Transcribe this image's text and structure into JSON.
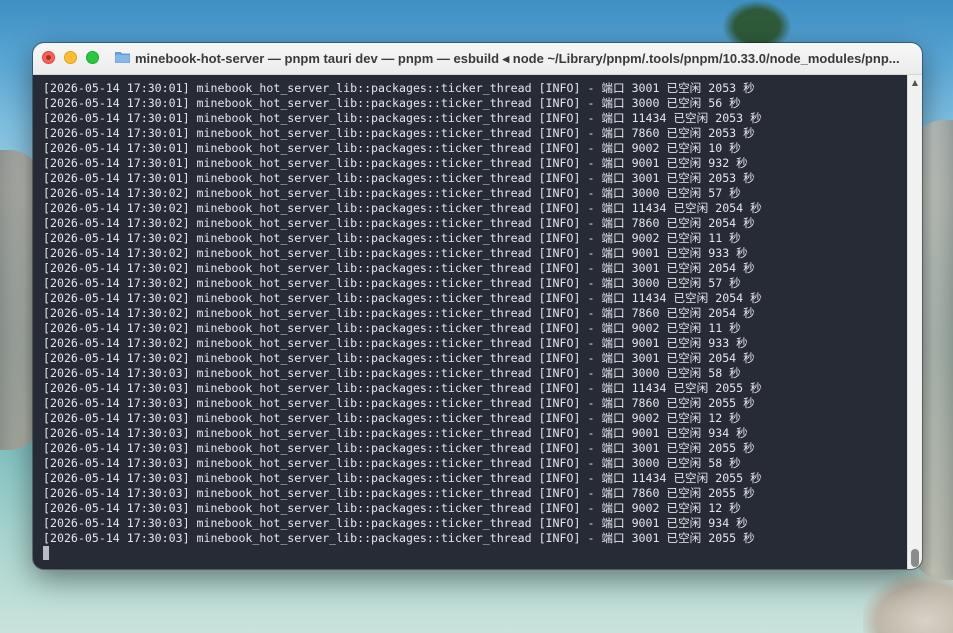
{
  "window": {
    "title": "minebook-hot-server — pnpm tauri dev — pnpm — esbuild ◂ node ~/Library/pnpm/.tools/pnpm/10.33.0/node_modules/pnp..."
  },
  "terminal": {
    "lines": [
      "[2026-05-14 17:30:01] minebook_hot_server_lib::packages::ticker_thread [INFO] - 端口 3001 已空闲 2053 秒",
      "[2026-05-14 17:30:01] minebook_hot_server_lib::packages::ticker_thread [INFO] - 端口 3000 已空闲 56 秒",
      "[2026-05-14 17:30:01] minebook_hot_server_lib::packages::ticker_thread [INFO] - 端口 11434 已空闲 2053 秒",
      "[2026-05-14 17:30:01] minebook_hot_server_lib::packages::ticker_thread [INFO] - 端口 7860 已空闲 2053 秒",
      "[2026-05-14 17:30:01] minebook_hot_server_lib::packages::ticker_thread [INFO] - 端口 9002 已空闲 10 秒",
      "[2026-05-14 17:30:01] minebook_hot_server_lib::packages::ticker_thread [INFO] - 端口 9001 已空闲 932 秒",
      "[2026-05-14 17:30:01] minebook_hot_server_lib::packages::ticker_thread [INFO] - 端口 3001 已空闲 2053 秒",
      "[2026-05-14 17:30:02] minebook_hot_server_lib::packages::ticker_thread [INFO] - 端口 3000 已空闲 57 秒",
      "[2026-05-14 17:30:02] minebook_hot_server_lib::packages::ticker_thread [INFO] - 端口 11434 已空闲 2054 秒",
      "[2026-05-14 17:30:02] minebook_hot_server_lib::packages::ticker_thread [INFO] - 端口 7860 已空闲 2054 秒",
      "[2026-05-14 17:30:02] minebook_hot_server_lib::packages::ticker_thread [INFO] - 端口 9002 已空闲 11 秒",
      "[2026-05-14 17:30:02] minebook_hot_server_lib::packages::ticker_thread [INFO] - 端口 9001 已空闲 933 秒",
      "[2026-05-14 17:30:02] minebook_hot_server_lib::packages::ticker_thread [INFO] - 端口 3001 已空闲 2054 秒",
      "[2026-05-14 17:30:02] minebook_hot_server_lib::packages::ticker_thread [INFO] - 端口 3000 已空闲 57 秒",
      "[2026-05-14 17:30:02] minebook_hot_server_lib::packages::ticker_thread [INFO] - 端口 11434 已空闲 2054 秒",
      "[2026-05-14 17:30:02] minebook_hot_server_lib::packages::ticker_thread [INFO] - 端口 7860 已空闲 2054 秒",
      "[2026-05-14 17:30:02] minebook_hot_server_lib::packages::ticker_thread [INFO] - 端口 9002 已空闲 11 秒",
      "[2026-05-14 17:30:02] minebook_hot_server_lib::packages::ticker_thread [INFO] - 端口 9001 已空闲 933 秒",
      "[2026-05-14 17:30:02] minebook_hot_server_lib::packages::ticker_thread [INFO] - 端口 3001 已空闲 2054 秒",
      "[2026-05-14 17:30:03] minebook_hot_server_lib::packages::ticker_thread [INFO] - 端口 3000 已空闲 58 秒",
      "[2026-05-14 17:30:03] minebook_hot_server_lib::packages::ticker_thread [INFO] - 端口 11434 已空闲 2055 秒",
      "[2026-05-14 17:30:03] minebook_hot_server_lib::packages::ticker_thread [INFO] - 端口 7860 已空闲 2055 秒",
      "[2026-05-14 17:30:03] minebook_hot_server_lib::packages::ticker_thread [INFO] - 端口 9002 已空闲 12 秒",
      "[2026-05-14 17:30:03] minebook_hot_server_lib::packages::ticker_thread [INFO] - 端口 9001 已空闲 934 秒",
      "[2026-05-14 17:30:03] minebook_hot_server_lib::packages::ticker_thread [INFO] - 端口 3001 已空闲 2055 秒",
      "[2026-05-14 17:30:03] minebook_hot_server_lib::packages::ticker_thread [INFO] - 端口 3000 已空闲 58 秒",
      "[2026-05-14 17:30:03] minebook_hot_server_lib::packages::ticker_thread [INFO] - 端口 11434 已空闲 2055 秒",
      "[2026-05-14 17:30:03] minebook_hot_server_lib::packages::ticker_thread [INFO] - 端口 7860 已空闲 2055 秒",
      "[2026-05-14 17:30:03] minebook_hot_server_lib::packages::ticker_thread [INFO] - 端口 9002 已空闲 12 秒",
      "[2026-05-14 17:30:03] minebook_hot_server_lib::packages::ticker_thread [INFO] - 端口 9001 已空闲 934 秒",
      "[2026-05-14 17:30:03] minebook_hot_server_lib::packages::ticker_thread [INFO] - 端口 3001 已空闲 2055 秒"
    ]
  },
  "colors": {
    "terminal_bg": "#272b36",
    "terminal_fg": "#e6e7ea",
    "close": "#fe5f57",
    "minimize": "#febc2e",
    "maximize": "#28c840",
    "folder": "#6aa6e0"
  },
  "icons": {
    "close": "close-icon",
    "minimize": "minimize-icon",
    "maximize": "zoom-icon",
    "title": "folder-icon"
  }
}
